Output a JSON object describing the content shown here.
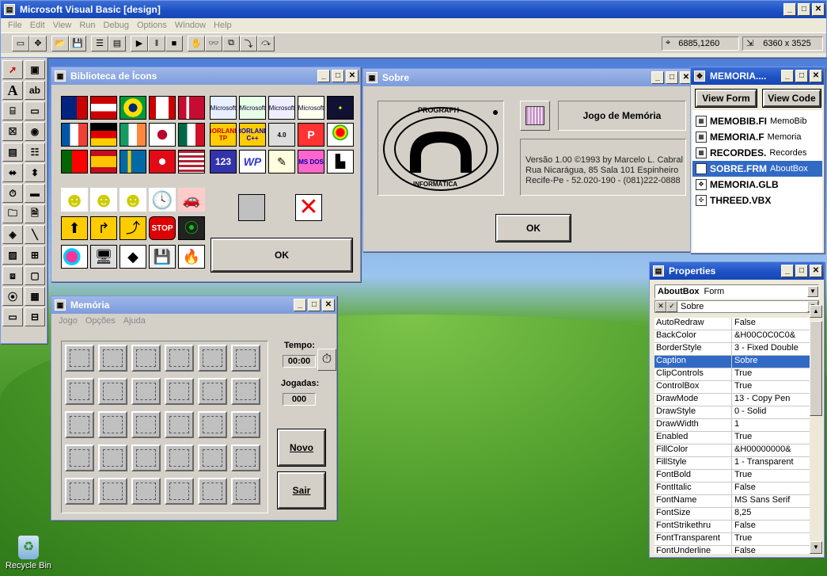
{
  "main": {
    "title": "Microsoft Visual Basic [design]",
    "menu": [
      "File",
      "Edit",
      "View",
      "Run",
      "Debug",
      "Options",
      "Window",
      "Help"
    ],
    "pos": "6885,1260",
    "size": "6360 x 3525"
  },
  "iconlib": {
    "title": "Biblioteca de Ícons",
    "ok": "OK",
    "brand_icons": [
      "Microsoft",
      "Microsoft",
      "Microsoft",
      "Microsoft",
      "",
      "BORLAND TP",
      "BORLAND C++",
      "4.0",
      "P",
      "",
      "123",
      "WP",
      "",
      "MS DOS",
      ""
    ]
  },
  "sobre": {
    "title": "Sobre",
    "logo_top": "PROGRAPH",
    "logo_bottom": "INFORMÁTICA",
    "game_title": "Jogo de Memória",
    "version": "Versão 1.00 ©1993 by Marcelo L. Cabral",
    "address": "Rua Nicarágua, 85 Sala 101 Espinheiro",
    "city": "Recife-Pe - 52.020-190 - (081)222-0888",
    "ok": "OK"
  },
  "project": {
    "title": "MEMORIA....",
    "view_form": "View Form",
    "view_code": "View Code",
    "files": [
      {
        "file": "MEMOBIB.FI",
        "name": "MemoBib"
      },
      {
        "file": "MEMORIA.F",
        "name": "Memoria"
      },
      {
        "file": "RECORDES.",
        "name": "Recordes"
      },
      {
        "file": "SOBRE.FRM",
        "name": "AboutBox"
      },
      {
        "file": "MEMORIA.GLB",
        "name": ""
      },
      {
        "file": "THREED.VBX",
        "name": ""
      }
    ]
  },
  "memoria": {
    "title": "Memória",
    "menu": [
      "Jogo",
      "Opções",
      "Ajuda"
    ],
    "tempo_label": "Tempo:",
    "tempo": "00:00",
    "jogadas_label": "Jogadas:",
    "jogadas": "000",
    "novo": "Novo",
    "sair": "Sair"
  },
  "props": {
    "title": "Properties",
    "object": "AboutBox",
    "object_type": "Form",
    "edit_value": "Sobre",
    "rows": [
      [
        "AutoRedraw",
        "False"
      ],
      [
        "BackColor",
        "&H00C0C0C0&"
      ],
      [
        "BorderStyle",
        "3 - Fixed Double"
      ],
      [
        "Caption",
        "Sobre"
      ],
      [
        "ClipControls",
        "True"
      ],
      [
        "ControlBox",
        "True"
      ],
      [
        "DrawMode",
        "13 - Copy Pen"
      ],
      [
        "DrawStyle",
        "0 - Solid"
      ],
      [
        "DrawWidth",
        "1"
      ],
      [
        "Enabled",
        "True"
      ],
      [
        "FillColor",
        "&H00000000&"
      ],
      [
        "FillStyle",
        "1 - Transparent"
      ],
      [
        "FontBold",
        "True"
      ],
      [
        "FontItalic",
        "False"
      ],
      [
        "FontName",
        "MS Sans Serif"
      ],
      [
        "FontSize",
        "8,25"
      ],
      [
        "FontStrikethru",
        "False"
      ],
      [
        "FontTransparent",
        "True"
      ],
      [
        "FontUnderline",
        "False"
      ]
    ]
  },
  "desktop": {
    "recycle_bin": "Recycle Bin"
  },
  "colors": {
    "title_active": "#1c4fc2",
    "selection": "#316ac5",
    "face": "#d4d0c8"
  }
}
